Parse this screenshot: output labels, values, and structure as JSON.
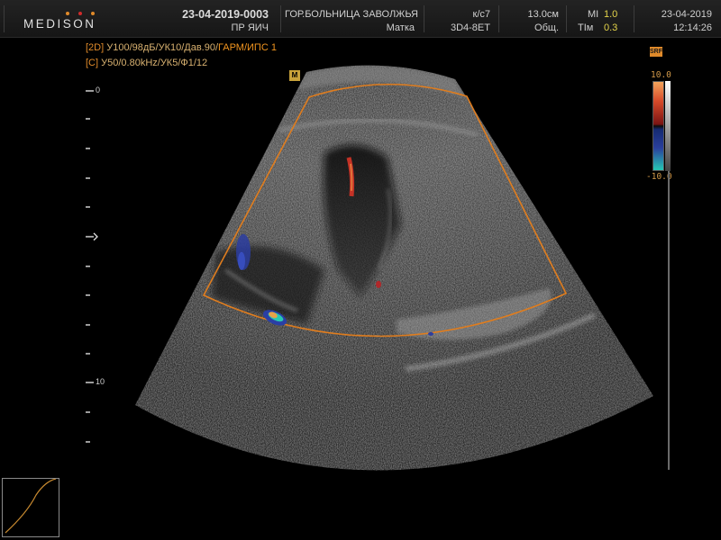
{
  "header": {
    "brand": "MEDISON",
    "patient_id": "23-04-2019-0003",
    "patient_name": "ПР ЯИЧ",
    "hospital": "ГОР.БОЛЬНИЦА ЗАВОЛЖЬЯ",
    "preset": "Матка",
    "frame_rate_label": "к/с7",
    "probe": "3D4-8ET",
    "depth": "13.0см",
    "mode": "Общ.",
    "mi_label": "MI",
    "mi_value": "1.0",
    "tim_label": "TIм",
    "tim_value": "0.3",
    "date": "23-04-2019",
    "time": "12:14:26"
  },
  "params": {
    "line1_tag": "[2D]",
    "line1_text": "У100/98дБ/УК10/Дав.90/",
    "line1_highlight": "ГАРМ/ИПС 1",
    "line2_tag": "[C]",
    "line2_text": "У50/0.80kHz/УК5/Ф1/12"
  },
  "depth_scale": {
    "label_top": "0",
    "label_bottom": "10"
  },
  "color_map": {
    "top_label": "10.0",
    "bottom_label": "-10.0",
    "badge": "SRF"
  },
  "focus_marker": "M",
  "colors": {
    "accent_orange": "#e08a2a",
    "roi_box": "#e07d1e",
    "mi_value": "#e4d44a"
  }
}
